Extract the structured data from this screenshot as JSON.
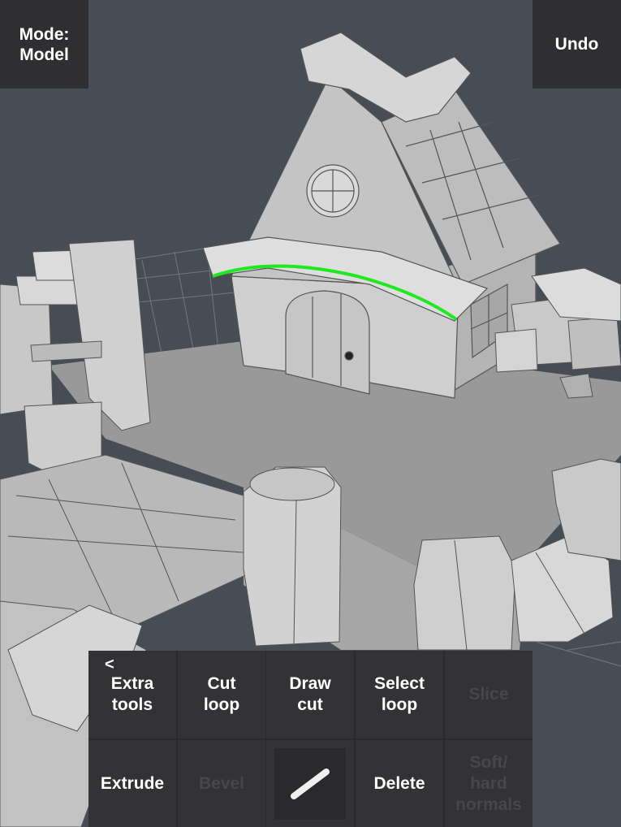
{
  "mode_panel": {
    "label": "Mode:\nModel"
  },
  "undo": {
    "label": "Undo"
  },
  "toolbar": {
    "back_arrow": "<",
    "extra_tools": "Extra\ntools",
    "cut_loop": "Cut\nloop",
    "draw_cut": "Draw\ncut",
    "select_loop": "Select\nloop",
    "slice": "Slice",
    "extrude": "Extrude",
    "bevel": "Bevel",
    "stroke_icon": "stroke-icon",
    "delete": "Delete",
    "soft_hard_normals": "Soft/\nhard\nnormals"
  },
  "colors": {
    "background": "#464d55",
    "panel": "#2f2f31",
    "selection": "#1ee81e",
    "mesh": "#c8c8c8",
    "disabled_text": "#474749"
  }
}
